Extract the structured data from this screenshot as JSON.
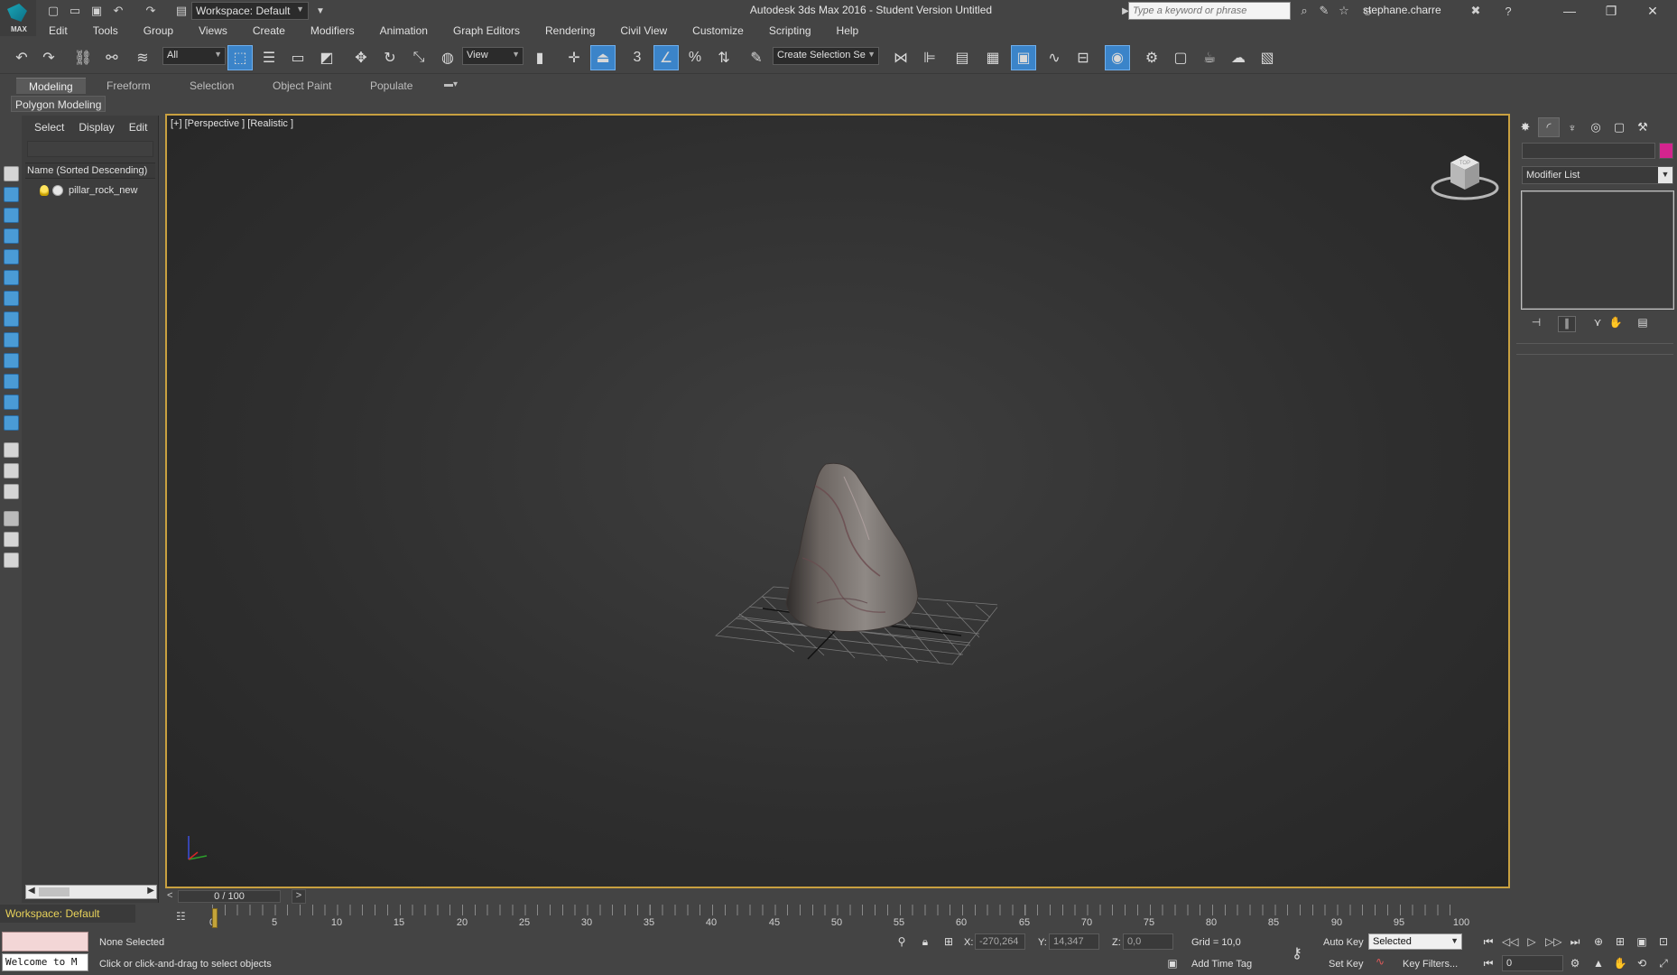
{
  "titlebar": {
    "logo_text": "MAX",
    "workspace": "Workspace: Default",
    "app_title": "Autodesk 3ds Max 2016 - Student Version    Untitled",
    "search_placeholder": "Type a keyword or phrase",
    "user": "stephane.charre"
  },
  "menu": [
    "Edit",
    "Tools",
    "Group",
    "Views",
    "Create",
    "Modifiers",
    "Animation",
    "Graph Editors",
    "Rendering",
    "Civil View",
    "Customize",
    "Scripting",
    "Help"
  ],
  "toolbar": {
    "filter_value": "All",
    "refcoord_value": "View",
    "selection_set_value": "Create Selection Se",
    "snap_3": "3"
  },
  "ribbon": {
    "tabs": [
      "Modeling",
      "Freeform",
      "Selection",
      "Object Paint",
      "Populate"
    ],
    "active_tab": "Modeling",
    "sub": "Polygon Modeling"
  },
  "explorer": {
    "menu": [
      "Select",
      "Display",
      "Edit"
    ],
    "header": "Name (Sorted Descending)",
    "objects": [
      "pillar_rock_new"
    ]
  },
  "viewport": {
    "label": "[+] [Perspective ] [Realistic ]",
    "viewcube_face": "TOP"
  },
  "command_panel": {
    "modifier_list": "Modifier List",
    "swatch_color": "#d4248e"
  },
  "timeslider": {
    "frame": "0 / 100"
  },
  "trackbar": {
    "numbers": [
      "0",
      "5",
      "10",
      "15",
      "20",
      "25",
      "30",
      "35",
      "40",
      "45",
      "50",
      "55",
      "60",
      "65",
      "70",
      "75",
      "80",
      "85",
      "90",
      "95",
      "100"
    ]
  },
  "workspace_label": "Workspace: Default",
  "status": {
    "maxscript": "Welcome to M",
    "selection": "None Selected",
    "prompt": "Click or click-and-drag to select objects",
    "x_label": "X:",
    "x_value": "-270,264",
    "y_label": "Y:",
    "y_value": "14,347",
    "z_label": "Z:",
    "z_value": "0,0",
    "grid": "Grid = 10,0",
    "add_time_tag": "Add Time Tag",
    "auto_key": "Auto Key",
    "set_key": "Set Key",
    "key_mode": "Selected",
    "key_filters": "Key Filters...",
    "current_frame": "0"
  }
}
